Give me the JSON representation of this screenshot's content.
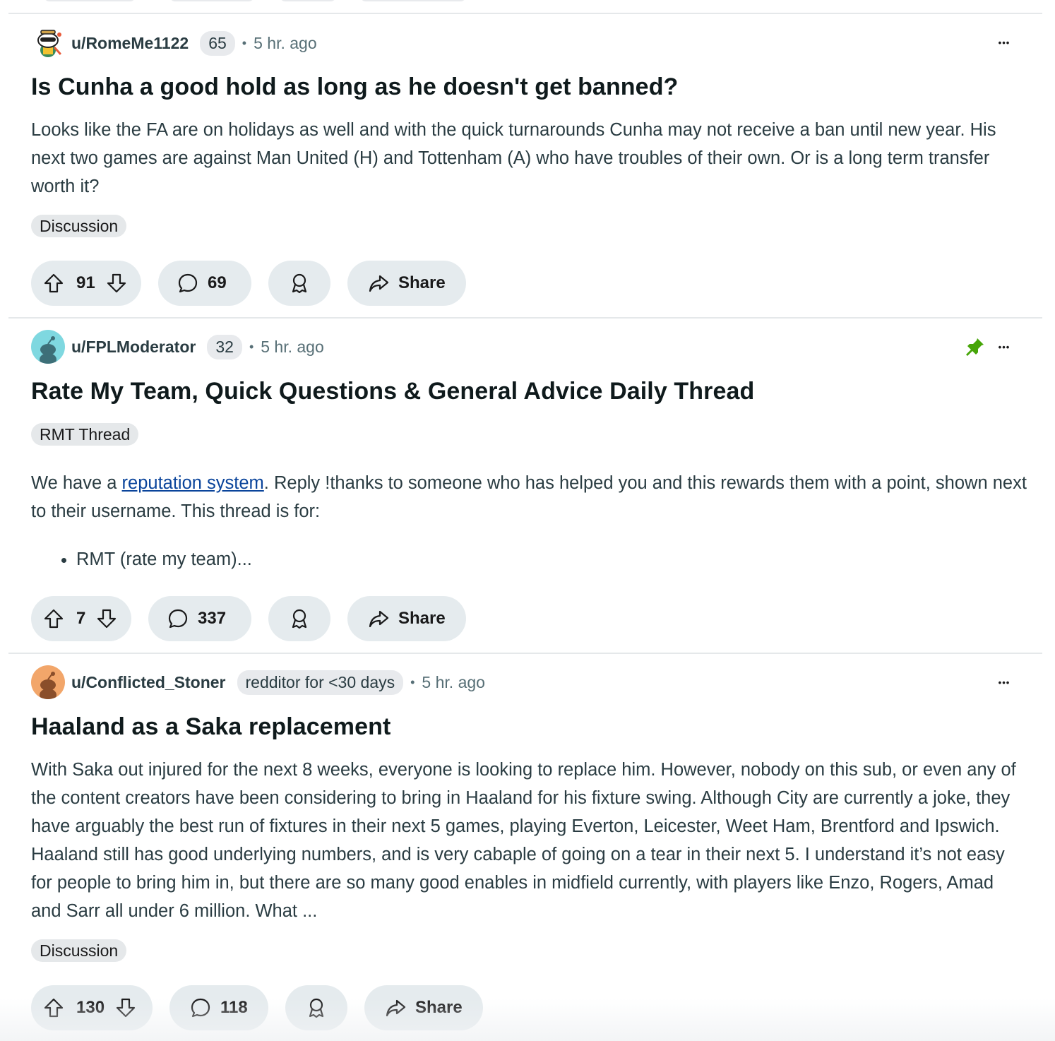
{
  "posts": [
    {
      "username": "u/RomeMe1122",
      "user_flair": "65",
      "time": "5 hr. ago",
      "title": "Is Cunha a good hold as long as he doesn't get banned?",
      "body": "Looks like the FA are on holidays as well and with the quick turnarounds Cunha may not receive a ban until new year. His next two games are against Man United (H) and Tottenham (A) who have troubles of their own. Or is a long term transfer worth it?",
      "post_flair": "Discussion",
      "votes": "91",
      "comments": "69",
      "share_label": "Share"
    },
    {
      "username": "u/FPLModerator",
      "user_flair": "32",
      "time": "5 hr. ago",
      "title": "Rate My Team, Quick Questions & General Advice Daily Thread",
      "post_flair": "RMT Thread",
      "body_prefix": "We have a ",
      "body_link": "reputation system",
      "body_suffix": ". Reply !thanks to someone who has helped you and this rewards them with a point, shown next to their username. This thread is for:",
      "bullet": "RMT (rate my team)...",
      "votes": "7",
      "comments": "337",
      "share_label": "Share"
    },
    {
      "username": "u/Conflicted_Stoner",
      "user_flair": "redditor for <30 days",
      "time": "5 hr. ago",
      "title": "Haaland as a Saka replacement",
      "body": "With Saka out injured for the next 8 weeks, everyone is looking to replace him. However, nobody on this sub, or even any of the content creators have been considering to bring in Haaland for his fixture swing. Although City are currently a joke, they have arguably the best run of fixtures in their next 5 games, playing Everton, Leicester, Weet Ham, Brentford and Ipswich. Haaland still has good underlying numbers, and is very cabaple of going on a tear in their next 5. I understand it’s not easy for people to bring him in, but there are so many good enables in midfield currently, with players like Enzo, Rogers, Amad and Sarr all under 6 million. What ...",
      "post_flair": "Discussion",
      "votes": "130",
      "comments": "118",
      "share_label": "Share"
    }
  ],
  "icons": {
    "more": "more-options-icon",
    "pin": "pin-icon",
    "upvote": "upvote-icon",
    "downvote": "downvote-icon",
    "comment": "comment-icon",
    "award": "award-icon",
    "share": "share-icon"
  },
  "colors": {
    "pin": "#46a508",
    "link": "#0a449b",
    "button_bg": "#e5ebee",
    "divider": "#e5e8ea"
  },
  "dots_glyph": "•••",
  "separator": "•"
}
